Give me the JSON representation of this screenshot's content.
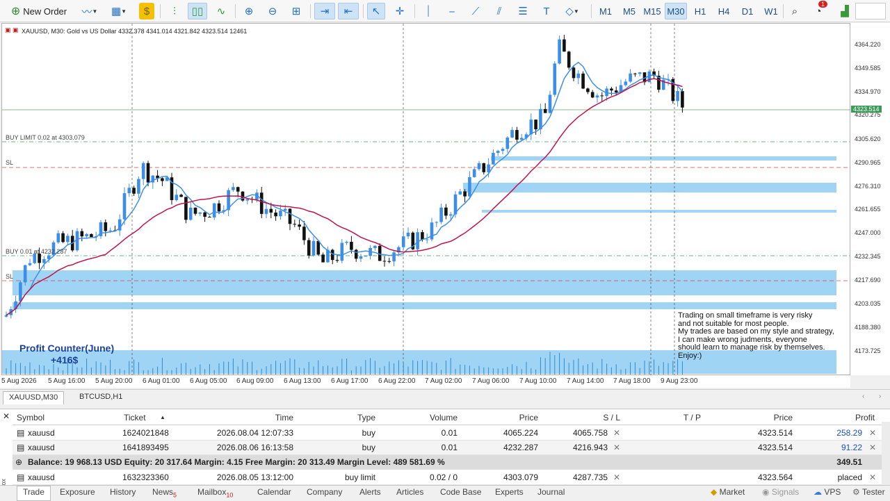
{
  "toolbar": {
    "new_order_label": "New Order",
    "timeframes": [
      "M1",
      "M5",
      "M15",
      "M30",
      "H1",
      "H4",
      "D1",
      "W1"
    ],
    "active_timeframe": "M30",
    "notifications_count": "1"
  },
  "chart": {
    "header": "XAUUSD, M30:  Gold vs US Dollar  4332.378 4341.014 4321.842 4323.514  12461",
    "current_price": "4323.514",
    "price_scale": [
      "4364.220",
      "4349.585",
      "4334.970",
      "4320.275",
      "4305.620",
      "4290.965",
      "4276.310",
      "4261.655",
      "4247.000",
      "4232.345",
      "4217.690",
      "4203.035",
      "4188.380",
      "4173.725"
    ],
    "time_labels": [
      "5 Aug 2026",
      "5 Aug 16:00",
      "5 Aug 20:00",
      "6 Aug 01:00",
      "6 Aug 05:00",
      "6 Aug 09:00",
      "6 Aug 13:00",
      "6 Aug 17:00",
      "6 Aug 22:00",
      "7 Aug 02:00",
      "7 Aug 06:00",
      "7 Aug 10:00",
      "7 Aug 14:00",
      "7 Aug 18:00",
      "9 Aug 23:00"
    ],
    "order_lines": {
      "buy_limit": "BUY LIMIT 0.02 at 4303.079",
      "sl_1": "SL",
      "buy": "BUY 0.01 at 4232.287",
      "sl_2": "SL"
    },
    "profit_counter_title": "Profit Counter(June)",
    "profit_counter_value": "+416$",
    "note_lines": [
      "Trading on small timeframe is very risky",
      "and not suitable for most people.",
      "My trades are based on my style and strategy,",
      "I can make wrong judments, everyone",
      "should learn to manage risk by themselves.",
      "Enjoy:)"
    ],
    "colors": {
      "bull": "#3d8ee8",
      "bear": "#111111",
      "ma_fast": "#3d8ee8",
      "ma_slow": "#c0134a",
      "zone": "#8fcdf2",
      "sl_line": "#e04040",
      "price_line": "#6aa06a"
    }
  },
  "chart_tabs": [
    "XAUUSD,M30",
    "BTCUSD,H1"
  ],
  "trade_table": {
    "headers": [
      "Symbol",
      "Ticket",
      "Time",
      "Type",
      "Volume",
      "Price",
      "S / L",
      "T / P",
      "Price",
      "Profit"
    ],
    "rows": [
      {
        "symbol": "xauusd",
        "ticket": "1624021848",
        "time": "2026.08.04 12:07:33",
        "type": "buy",
        "volume": "0.01",
        "price": "4065.224",
        "sl": "4065.758",
        "tp": "",
        "cur_price": "4323.514",
        "profit": "258.29"
      },
      {
        "symbol": "xauusd",
        "ticket": "1641893495",
        "time": "2026.08.06 16:13:58",
        "type": "buy",
        "volume": "0.01",
        "price": "4232.287",
        "sl": "4216.943",
        "tp": "",
        "cur_price": "4323.514",
        "profit": "91.22"
      }
    ],
    "balance_line": "Balance: 19 968.13 USD  Equity: 20 317.64  Margin: 4.15  Free Margin: 20 313.49  Margin Level: 489 581.69 %",
    "balance_profit": "349.51",
    "pending": {
      "symbol": "xauusd",
      "ticket": "1632323360",
      "time": "2026.08.05 13:12:00",
      "type": "buy limit",
      "volume": "0.02 / 0",
      "price": "4303.079",
      "sl": "4287.735",
      "tp": "",
      "cur_price": "4323.564",
      "profit": "placed"
    }
  },
  "bottom_tabs": {
    "items": [
      "Trade",
      "Exposure",
      "History",
      "News",
      "Mailbox",
      "Calendar",
      "Company",
      "Alerts",
      "Articles",
      "Code Base",
      "Experts",
      "Journal"
    ],
    "news_badge": "5",
    "mailbox_badge": "10",
    "right": [
      "Market",
      "Signals",
      "VPS",
      "Tester"
    ],
    "toolbox_label": "Toolbox"
  }
}
